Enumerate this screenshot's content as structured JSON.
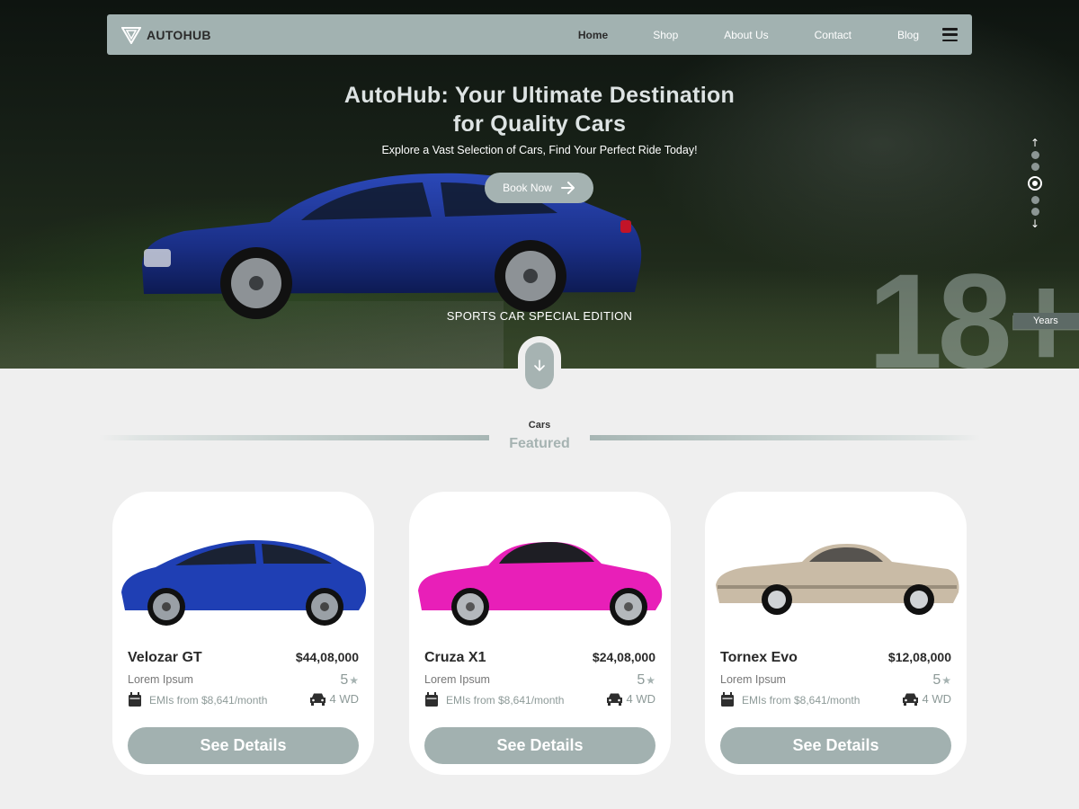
{
  "brand": {
    "name": "AUTOHUB"
  },
  "nav": {
    "items": [
      {
        "label": "Home",
        "active": true
      },
      {
        "label": "Shop",
        "active": false
      },
      {
        "label": "About Us",
        "active": false
      },
      {
        "label": "Contact",
        "active": false
      },
      {
        "label": "Blog",
        "active": false
      }
    ],
    "menu_icon": "hamburger-icon"
  },
  "hero": {
    "title_line1": "AutoHub: Your Ultimate Destination",
    "title_line2": "for Quality Cars",
    "subtitle": "Explore a Vast Selection of Cars, Find Your Perfect Ride Today!",
    "cta_label": "Book Now",
    "caption": "SPORTS CAR SPECIAL EDITION",
    "stat_number": "18+",
    "stat_label": "Years",
    "slides_total": 5,
    "slide_active": 3
  },
  "section": {
    "kicker": "Cars",
    "title": "Featured"
  },
  "cars": [
    {
      "name": "Velozar GT",
      "price": "$44,08,000",
      "subtitle": "Lorem Ipsum",
      "rating": "5",
      "emi": "EMIs from $8,641/month",
      "drive": "4 WD",
      "button": "See Details",
      "color": "#1f3fb4"
    },
    {
      "name": "Cruza X1",
      "price": "$24,08,000",
      "subtitle": "Lorem Ipsum",
      "rating": "5",
      "emi": "EMIs from $8,641/month",
      "drive": "4 WD",
      "button": "See Details",
      "color": "#e81fb8"
    },
    {
      "name": "Tornex Evo",
      "price": "$12,08,000",
      "subtitle": "Lorem Ipsum",
      "rating": "5",
      "emi": "EMIs from $8,641/month",
      "drive": "4 WD",
      "button": "See Details",
      "color": "#c9bba6"
    }
  ],
  "colors": {
    "accent": "#a2b2b1",
    "page_bg": "#efefef"
  }
}
